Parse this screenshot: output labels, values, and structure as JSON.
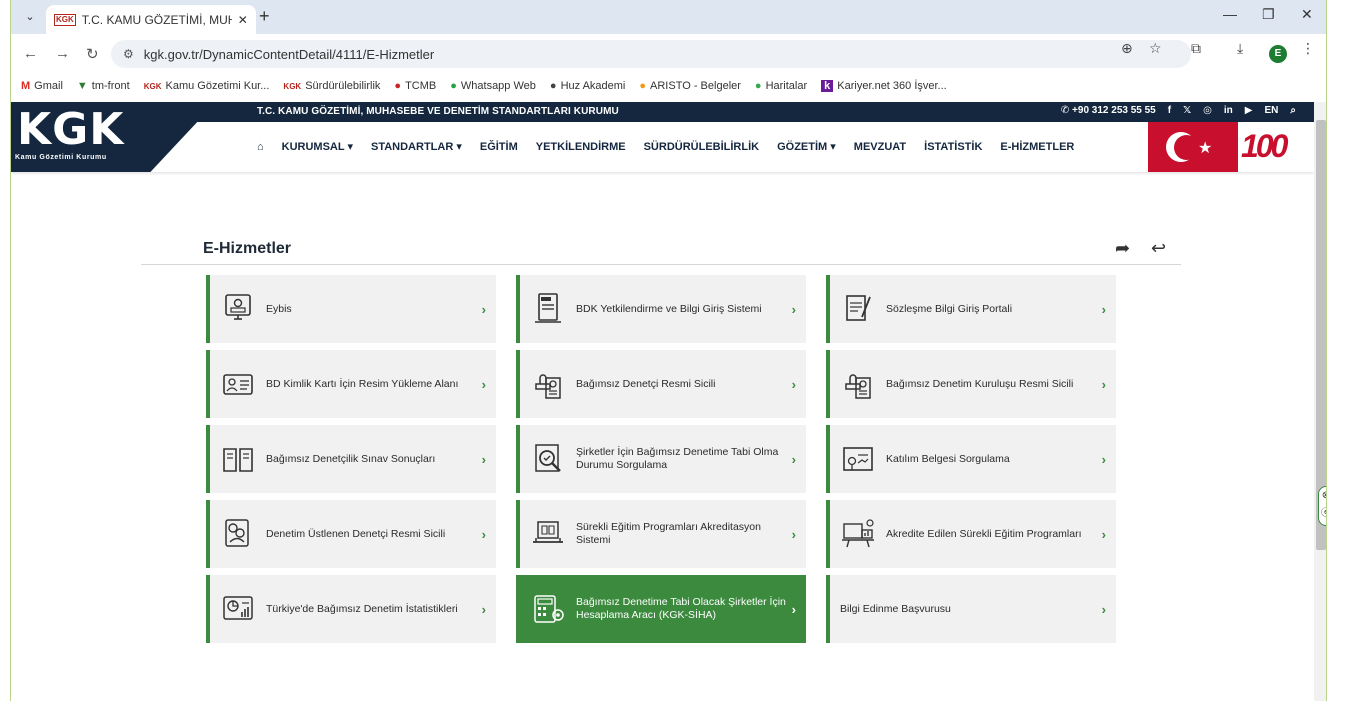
{
  "browser": {
    "tab_title": "T.C. KAMU GÖZETİMİ, MUHASE",
    "favicon_text": "KGK",
    "url": "kgk.gov.tr/DynamicContentDetail/4111/E-Hizmetler",
    "profile_letter": "E",
    "bookmarks": [
      {
        "label": "Gmail",
        "icon": "M"
      },
      {
        "label": "tm-front",
        "icon": "▼"
      },
      {
        "label": "Kamu Gözetimi Kur...",
        "icon": "KGK"
      },
      {
        "label": "Sürdürülebilirlik",
        "icon": "KGK"
      },
      {
        "label": "TCMB",
        "icon": "●"
      },
      {
        "label": "Whatsapp Web",
        "icon": "●"
      },
      {
        "label": "Huz Akademi",
        "icon": "●"
      },
      {
        "label": "ARISTO - Belgeler",
        "icon": "●"
      },
      {
        "label": "Haritalar",
        "icon": "●"
      },
      {
        "label": "Kariyer.net 360 İşver...",
        "icon": "k"
      }
    ]
  },
  "site": {
    "org_title": "T.C. KAMU GÖZETİMİ, MUHASEBE VE DENETİM STANDARTLARI KURUMU",
    "phone": "+90 312 253 55 55",
    "lang": "EN",
    "logo_text": "KGK",
    "logo_sub": "Kamu Gözetimi Kurumu",
    "anniversary": "100",
    "nav": [
      "KURUMSAL ▾",
      "STANDARTLAR ▾",
      "EĞİTİM",
      "YETKİLENDİRME",
      "SÜRDÜRÜLEBİLİRLİK",
      "GÖZETİM ▾",
      "MEVZUAT",
      "İSTATİSTİK",
      "E-HİZMETLER"
    ]
  },
  "page": {
    "title": "E-Hizmetler",
    "accent_color": "#3b8a3e",
    "cards": [
      {
        "label": "Eybis",
        "icon": "monitor-icon"
      },
      {
        "label": "BDK Yetkilendirme ve Bilgi Giriş Sistemi",
        "icon": "document-icon"
      },
      {
        "label": "Sözleşme Bilgi Giriş Portali",
        "icon": "contract-icon"
      },
      {
        "label": "BD Kimlik Kartı İçin Resim Yükleme Alanı",
        "icon": "id-card-icon"
      },
      {
        "label": "Bağımsız Denetçi Resmi Sicili",
        "icon": "stamp-icon"
      },
      {
        "label": "Bağımsız Denetim Kuruluşu Resmi Sicili",
        "icon": "stamp-icon"
      },
      {
        "label": "Bağımsız Denetçilik Sınav Sonuçları",
        "icon": "book-icon"
      },
      {
        "label": "Şirketler İçin Bağımsız Denetime Tabi Olma Durumu Sorgulama",
        "icon": "magnifier-icon"
      },
      {
        "label": "Katılım Belgesi Sorgulama",
        "icon": "certificate-icon"
      },
      {
        "label": "Denetim Üstlenen Denetçi Resmi Sicili",
        "icon": "auditor-icon"
      },
      {
        "label": "Sürekli Eğitim Programları Akreditasyon Sistemi",
        "icon": "laptop-book-icon"
      },
      {
        "label": "Akredite Edilen Sürekli Eğitim Programları",
        "icon": "training-icon"
      },
      {
        "label": "Türkiye'de Bağımsız Denetim İstatistikleri",
        "icon": "statistics-icon"
      },
      {
        "label": "Bağımsız Denetime Tabi Olacak Şirketler İçin Hesaplama Aracı (KGK-SİHA)",
        "icon": "calculator-icon",
        "active": true
      },
      {
        "label": "Bilgi Edinme Başvurusu",
        "icon": ""
      }
    ]
  }
}
